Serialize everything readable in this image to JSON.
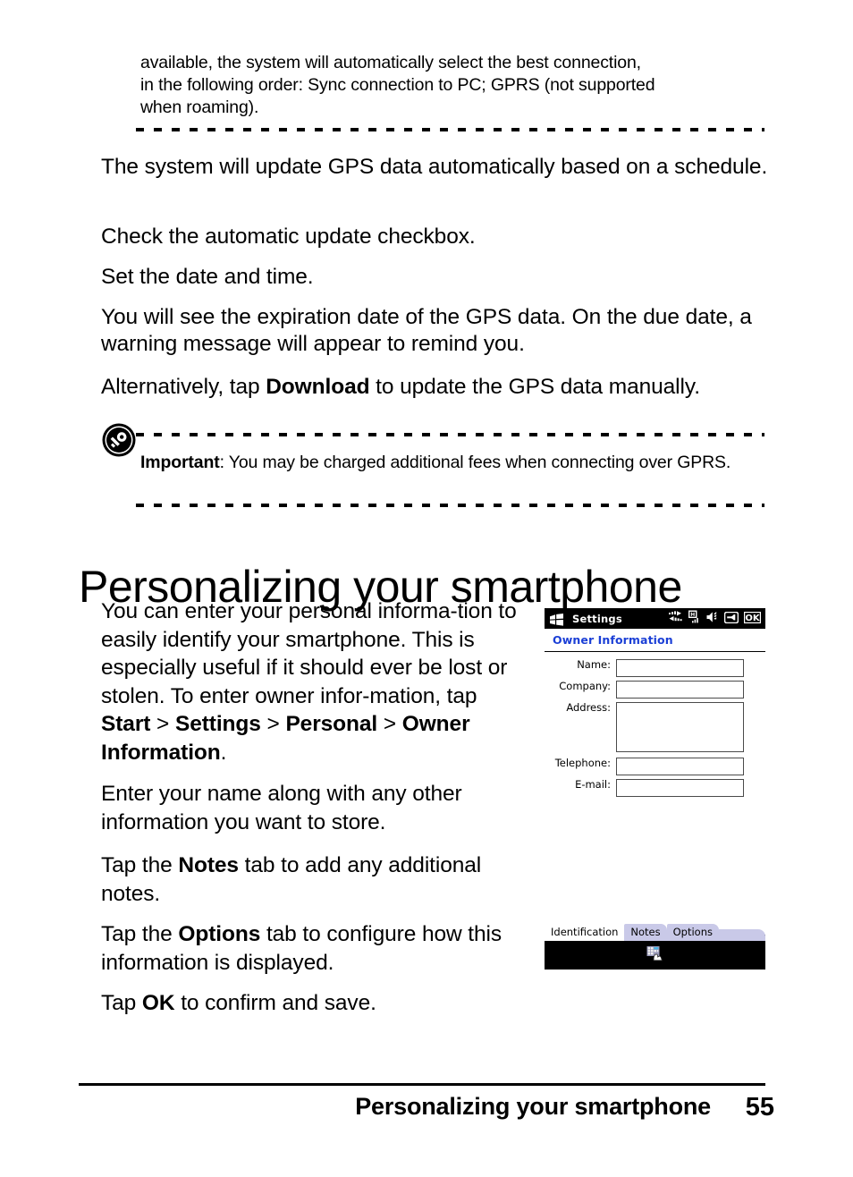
{
  "note_top": {
    "lines": [
      "available, the system will automatically select the best connection,",
      "in the following order: Sync connection to PC; GPRS (not supported",
      "when roaming)."
    ],
    "full_text": "available, the system will automatically select the best connection, in the following order: Sync connection to PC; GPRS (not supported when roaming)."
  },
  "paragraphs": {
    "p1": "The system will update GPS data automatically based on a schedule.",
    "p2": "Check the automatic update checkbox.",
    "p3": "Set the date and time.",
    "p4": "You will see the expiration date of the GPS data. On the due date, a warning message will appear to remind you.",
    "p5_prefix": "Alternatively, tap ",
    "p5_bold": "Download",
    "p5_suffix": " to update the GPS data manually."
  },
  "important_note": {
    "icon": "key-icon",
    "label": "Important",
    "separator": ": ",
    "text": "You may be charged additional fees when connecting over GPRS."
  },
  "heading": "Personalizing your smartphone",
  "column_text": {
    "c1_a": "You can enter your personal informa-tion to easily identify your smartphone. This is especially useful if it should ever be lost or stolen. To enter owner infor-mation, tap ",
    "c1_start": "Start",
    "c1_gt1": " > ",
    "c1_settings": "Settings",
    "c1_gt2": " > ",
    "c1_personal": "Personal",
    "c1_gt3": " > ",
    "c1_owner": "Owner Information",
    "c1_end": ".",
    "c2": "Enter your name along with any other information you want to store.",
    "c3_prefix": "Tap the ",
    "c3_bold": "Notes",
    "c3_suffix": " tab to add any additional notes.",
    "c4_prefix": "Tap the ",
    "c4_bold": "Options",
    "c4_suffix": " tab to configure how this information is displayed.",
    "c5_prefix": "Tap ",
    "c5_bold": "OK",
    "c5_suffix": " to confirm and save."
  },
  "phone": {
    "title": "Settings",
    "header": "Owner Information",
    "header_color": "#1b3fd6",
    "status_icons": [
      "connectivity-icon",
      "signal-h-icon",
      "volume-icon",
      "input-icon",
      "ok-icon"
    ],
    "ok_label": "OK",
    "signal_letter": "H",
    "fields": [
      {
        "label": "Name:",
        "value": ""
      },
      {
        "label": "Company:",
        "value": ""
      },
      {
        "label": "Address:",
        "value": ""
      },
      {
        "label": "Telephone:",
        "value": ""
      },
      {
        "label": "E-mail:",
        "value": ""
      }
    ],
    "tabs": [
      {
        "label": "Identification",
        "active": true
      },
      {
        "label": "Notes",
        "active": false
      },
      {
        "label": "Options",
        "active": false
      }
    ],
    "sip_icon": "soft-input-panel-icon"
  },
  "footer": {
    "title": "Personalizing your smartphone",
    "page_number": "55"
  }
}
